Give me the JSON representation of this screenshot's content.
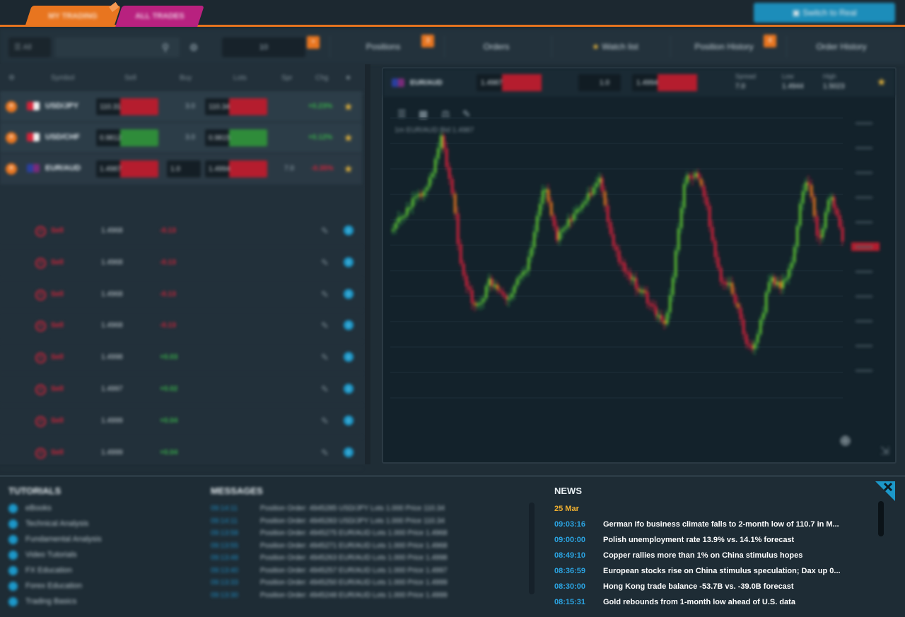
{
  "top_tabs": [
    "MY TRADING",
    "ALL TRADES"
  ],
  "switch_button": "Switch to Real",
  "toolbar": {
    "account": "All",
    "lot": "10",
    "nav": [
      "Positions",
      "Orders",
      "Watch list",
      "Position History",
      "Order History"
    ],
    "badges": [
      "3",
      "4",
      "1"
    ]
  },
  "watchlist": {
    "headers": [
      "Symbol",
      "Sell",
      "Buy",
      "Lots",
      "Spr",
      "Chg"
    ],
    "rows": [
      {
        "symbol": "USD/JPY",
        "sell": "110.31",
        "buy": "110.34",
        "spread": "3.0",
        "change": "+0.23%"
      },
      {
        "symbol": "USD/CHF",
        "sell": "0.9812",
        "buy": "0.9815",
        "spread": "3.0",
        "change": "+0.12%"
      },
      {
        "symbol": "EUR/AUD",
        "sell": "1.4987",
        "buy": "1.4994",
        "spread": "7.0",
        "change": "-0.35%"
      }
    ],
    "trades": [
      {
        "side": "Sell",
        "open": "1.4968",
        "pl": "-0.13",
        "sign": "-"
      },
      {
        "side": "Sell",
        "open": "1.4968",
        "pl": "-0.13",
        "sign": "-"
      },
      {
        "side": "Sell",
        "open": "1.4968",
        "pl": "-0.13",
        "sign": "-"
      },
      {
        "side": "Sell",
        "open": "1.4968",
        "pl": "-0.13",
        "sign": "-"
      },
      {
        "side": "Sell",
        "open": "1.4998",
        "pl": "+0.03",
        "sign": "+"
      },
      {
        "side": "Sell",
        "open": "1.4997",
        "pl": "+0.02",
        "sign": "+"
      },
      {
        "side": "Sell",
        "open": "1.4999",
        "pl": "+0.04",
        "sign": "+"
      },
      {
        "side": "Sell",
        "open": "1.4999",
        "pl": "+0.04",
        "sign": "+"
      },
      {
        "side": "Sell",
        "open": "1.4999",
        "pl": "+0.04",
        "sign": "+"
      }
    ]
  },
  "chart_panel": {
    "symbol": "EUR/AUD",
    "sell": "1.4987",
    "buy": "1.4994",
    "lots": "1.0",
    "stats": [
      {
        "label": "Spread",
        "value": "7.0"
      },
      {
        "label": "Low",
        "value": "1.4944"
      },
      {
        "label": "High",
        "value": "1.5023"
      }
    ],
    "info": "1m  EUR/AUD  Bid  1.4987"
  },
  "tutorials": {
    "title": "TUTORIALS",
    "items": [
      "eBooks",
      "Technical Analysis",
      "Fundamental Analysis",
      "Video Tutorials",
      "FX Education",
      "Forex Education",
      "Trading Basics"
    ]
  },
  "messages": {
    "title": "MESSAGES",
    "items": [
      {
        "time": "09:14:11",
        "text": "Position Order: 4945285 USD/JPY Lots 1.000 Price 110.34"
      },
      {
        "time": "09:14:11",
        "text": "Position Order: 4945283 USD/JPY Lots 1.000 Price 110.34"
      },
      {
        "time": "09:13:58",
        "text": "Position Order: 4945275 EUR/AUD Lots 1.000 Price 1.4968"
      },
      {
        "time": "09:13:55",
        "text": "Position Order: 4945271 EUR/AUD Lots 1.000 Price 1.4968"
      },
      {
        "time": "09:13:48",
        "text": "Position Order: 4945263 EUR/AUD Lots 1.000 Price 1.4998"
      },
      {
        "time": "09:13:40",
        "text": "Position Order: 4945257 EUR/AUD Lots 1.000 Price 1.4997"
      },
      {
        "time": "09:13:33",
        "text": "Position Order: 4945250 EUR/AUD Lots 1.000 Price 1.4999"
      },
      {
        "time": "09:13:30",
        "text": "Position Order: 4945248 EUR/AUD Lots 1.000 Price 1.4999"
      }
    ]
  },
  "news": {
    "title": "NEWS",
    "date": "25 Mar",
    "items": [
      {
        "time": "09:03:16",
        "text": "German Ifo business climate falls to 2-month low of 110.7 in M..."
      },
      {
        "time": "09:00:00",
        "text": "Polish unemployment rate 13.9% vs. 14.1% forecast"
      },
      {
        "time": "08:49:10",
        "text": "Copper rallies more than 1% on China stimulus hopes"
      },
      {
        "time": "08:36:59",
        "text": "European stocks rise on China stimulus speculation; Dax up 0..."
      },
      {
        "time": "08:30:00",
        "text": "Hong Kong trade balance -53.7B vs. -39.0B forecast"
      },
      {
        "time": "08:15:31",
        "text": "Gold rebounds from 1-month low ahead of U.S. data"
      }
    ]
  },
  "colors": {
    "accent": "#e8751f",
    "up": "#39b24a",
    "down": "#d8243a",
    "link": "#2ba4e2",
    "date": "#f0b030"
  }
}
